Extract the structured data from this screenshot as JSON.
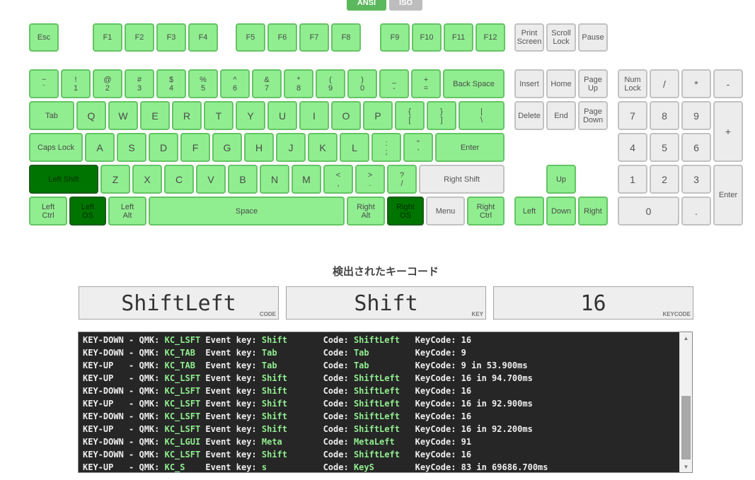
{
  "layout_tabs": [
    {
      "label": "ANSI",
      "active": true
    },
    {
      "label": "ISO",
      "active": false
    }
  ],
  "keyboard": {
    "keys": [
      {
        "label": "Esc",
        "state": "tested"
      },
      {
        "label": "F1",
        "state": "tested"
      },
      {
        "label": "F2",
        "state": "tested"
      },
      {
        "label": "F3",
        "state": "tested"
      },
      {
        "label": "F4",
        "state": "tested"
      },
      {
        "label": "F5",
        "state": "tested"
      },
      {
        "label": "F6",
        "state": "tested"
      },
      {
        "label": "F7",
        "state": "tested"
      },
      {
        "label": "F8",
        "state": "tested"
      },
      {
        "label": "F9",
        "state": "tested"
      },
      {
        "label": "F10",
        "state": "tested"
      },
      {
        "label": "F11",
        "state": "tested"
      },
      {
        "label": "F12",
        "state": "tested"
      },
      {
        "label": "Print\nScreen",
        "state": "untested"
      },
      {
        "label": "Scroll\nLock",
        "state": "untested"
      },
      {
        "label": "Pause",
        "state": "untested"
      },
      {
        "label": "~\n`",
        "state": "tested"
      },
      {
        "label": "!\n1",
        "state": "tested"
      },
      {
        "label": "@\n2",
        "state": "tested"
      },
      {
        "label": "#\n3",
        "state": "tested"
      },
      {
        "label": "$\n4",
        "state": "tested"
      },
      {
        "label": "%\n5",
        "state": "tested"
      },
      {
        "label": "^\n6",
        "state": "tested"
      },
      {
        "label": "&\n7",
        "state": "tested"
      },
      {
        "label": "*\n8",
        "state": "tested"
      },
      {
        "label": "(\n9",
        "state": "tested"
      },
      {
        "label": ")\n0",
        "state": "tested"
      },
      {
        "label": "_\n-",
        "state": "tested"
      },
      {
        "label": "+\n=",
        "state": "tested"
      },
      {
        "label": "Back Space",
        "state": "tested"
      },
      {
        "label": "Insert",
        "state": "untested"
      },
      {
        "label": "Home",
        "state": "untested"
      },
      {
        "label": "Page\nUp",
        "state": "untested"
      },
      {
        "label": "Num\nLock",
        "state": "untested"
      },
      {
        "label": "/",
        "state": "untested"
      },
      {
        "label": "*",
        "state": "untested"
      },
      {
        "label": "-",
        "state": "untested"
      },
      {
        "label": "Tab",
        "state": "tested"
      },
      {
        "label": "Q",
        "state": "tested"
      },
      {
        "label": "W",
        "state": "tested"
      },
      {
        "label": "E",
        "state": "tested"
      },
      {
        "label": "R",
        "state": "tested"
      },
      {
        "label": "T",
        "state": "tested"
      },
      {
        "label": "Y",
        "state": "tested"
      },
      {
        "label": "U",
        "state": "tested"
      },
      {
        "label": "I",
        "state": "tested"
      },
      {
        "label": "O",
        "state": "tested"
      },
      {
        "label": "P",
        "state": "tested"
      },
      {
        "label": "{\n[",
        "state": "tested"
      },
      {
        "label": "}\n]",
        "state": "tested"
      },
      {
        "label": "|\n\\",
        "state": "tested"
      },
      {
        "label": "Delete",
        "state": "untested"
      },
      {
        "label": "End",
        "state": "untested"
      },
      {
        "label": "Page\nDown",
        "state": "untested"
      },
      {
        "label": "7",
        "state": "untested"
      },
      {
        "label": "8",
        "state": "untested"
      },
      {
        "label": "9",
        "state": "untested"
      },
      {
        "label": "+",
        "state": "untested"
      },
      {
        "label": "Caps Lock",
        "state": "tested"
      },
      {
        "label": "A",
        "state": "tested"
      },
      {
        "label": "S",
        "state": "tested"
      },
      {
        "label": "D",
        "state": "tested"
      },
      {
        "label": "F",
        "state": "tested"
      },
      {
        "label": "G",
        "state": "tested"
      },
      {
        "label": "H",
        "state": "tested"
      },
      {
        "label": "J",
        "state": "tested"
      },
      {
        "label": "K",
        "state": "tested"
      },
      {
        "label": "L",
        "state": "tested"
      },
      {
        "label": ":\n;",
        "state": "tested"
      },
      {
        "label": "\"\n'",
        "state": "tested"
      },
      {
        "label": "Enter",
        "state": "tested"
      },
      {
        "label": "4",
        "state": "untested"
      },
      {
        "label": "5",
        "state": "untested"
      },
      {
        "label": "6",
        "state": "untested"
      },
      {
        "label": "Left Shift",
        "state": "pressed"
      },
      {
        "label": "Z",
        "state": "tested"
      },
      {
        "label": "X",
        "state": "tested"
      },
      {
        "label": "C",
        "state": "tested"
      },
      {
        "label": "V",
        "state": "tested"
      },
      {
        "label": "B",
        "state": "tested"
      },
      {
        "label": "N",
        "state": "tested"
      },
      {
        "label": "M",
        "state": "tested"
      },
      {
        "label": "<\n,",
        "state": "tested"
      },
      {
        "label": ">\n.",
        "state": "tested"
      },
      {
        "label": "?\n/",
        "state": "tested"
      },
      {
        "label": "Right Shift",
        "state": "untested"
      },
      {
        "label": "Up",
        "state": "tested"
      },
      {
        "label": "1",
        "state": "untested"
      },
      {
        "label": "2",
        "state": "untested"
      },
      {
        "label": "3",
        "state": "untested"
      },
      {
        "label": "Enter",
        "state": "untested"
      },
      {
        "label": "Left\nCtrl",
        "state": "tested"
      },
      {
        "label": "Left\nOS",
        "state": "pressed"
      },
      {
        "label": "Left\nAlt",
        "state": "tested"
      },
      {
        "label": "Space",
        "state": "tested"
      },
      {
        "label": "Right\nAlt",
        "state": "tested"
      },
      {
        "label": "Right\nOS",
        "state": "pressed"
      },
      {
        "label": "Menu",
        "state": "untested"
      },
      {
        "label": "Right\nCtrl",
        "state": "tested"
      },
      {
        "label": "Left",
        "state": "tested"
      },
      {
        "label": "Down",
        "state": "tested"
      },
      {
        "label": "Right",
        "state": "tested"
      },
      {
        "label": "0",
        "state": "untested"
      },
      {
        "label": ".",
        "state": "untested"
      }
    ]
  },
  "detection": {
    "title": "検出されたキーコード",
    "code": {
      "value": "ShiftLeft",
      "label": "CODE"
    },
    "key": {
      "value": "Shift",
      "label": "KEY"
    },
    "keycode": {
      "value": "16",
      "label": "KEYCODE"
    }
  },
  "log": [
    {
      "event": "KEY-DOWN",
      "qmk": "KC_LSFT",
      "key": "Shift",
      "code": "ShiftLeft",
      "keycode": "16"
    },
    {
      "event": "KEY-DOWN",
      "qmk": "KC_TAB",
      "key": "Tab",
      "code": "Tab",
      "keycode": "9"
    },
    {
      "event": "KEY-UP",
      "qmk": "KC_TAB",
      "key": "Tab",
      "code": "Tab",
      "keycode": "9 in 53.900ms"
    },
    {
      "event": "KEY-UP",
      "qmk": "KC_LSFT",
      "key": "Shift",
      "code": "ShiftLeft",
      "keycode": "16 in 94.700ms"
    },
    {
      "event": "KEY-DOWN",
      "qmk": "KC_LSFT",
      "key": "Shift",
      "code": "ShiftLeft",
      "keycode": "16"
    },
    {
      "event": "KEY-UP",
      "qmk": "KC_LSFT",
      "key": "Shift",
      "code": "ShiftLeft",
      "keycode": "16 in 92.900ms"
    },
    {
      "event": "KEY-DOWN",
      "qmk": "KC_LSFT",
      "key": "Shift",
      "code": "ShiftLeft",
      "keycode": "16"
    },
    {
      "event": "KEY-UP",
      "qmk": "KC_LSFT",
      "key": "Shift",
      "code": "ShiftLeft",
      "keycode": "16 in 92.200ms"
    },
    {
      "event": "KEY-DOWN",
      "qmk": "KC_LGUI",
      "key": "Meta",
      "code": "MetaLeft",
      "keycode": "91"
    },
    {
      "event": "KEY-DOWN",
      "qmk": "KC_LSFT",
      "key": "Shift",
      "code": "ShiftLeft",
      "keycode": "16"
    },
    {
      "event": "KEY-UP",
      "qmk": "KC_S",
      "key": "s",
      "code": "KeyS",
      "keycode": "83 in 69686.700ms"
    }
  ],
  "log_text": {
    "qmk_prefix": "QMK:",
    "key_prefix": "Event key:",
    "code_prefix": "Code:",
    "keycode_prefix": "KeyCode:"
  },
  "colors": {
    "tested": "#90ee90",
    "pressed": "#007400",
    "untested": "#ececec",
    "log_bg": "#262626",
    "log_highlight": "#90ee90"
  }
}
